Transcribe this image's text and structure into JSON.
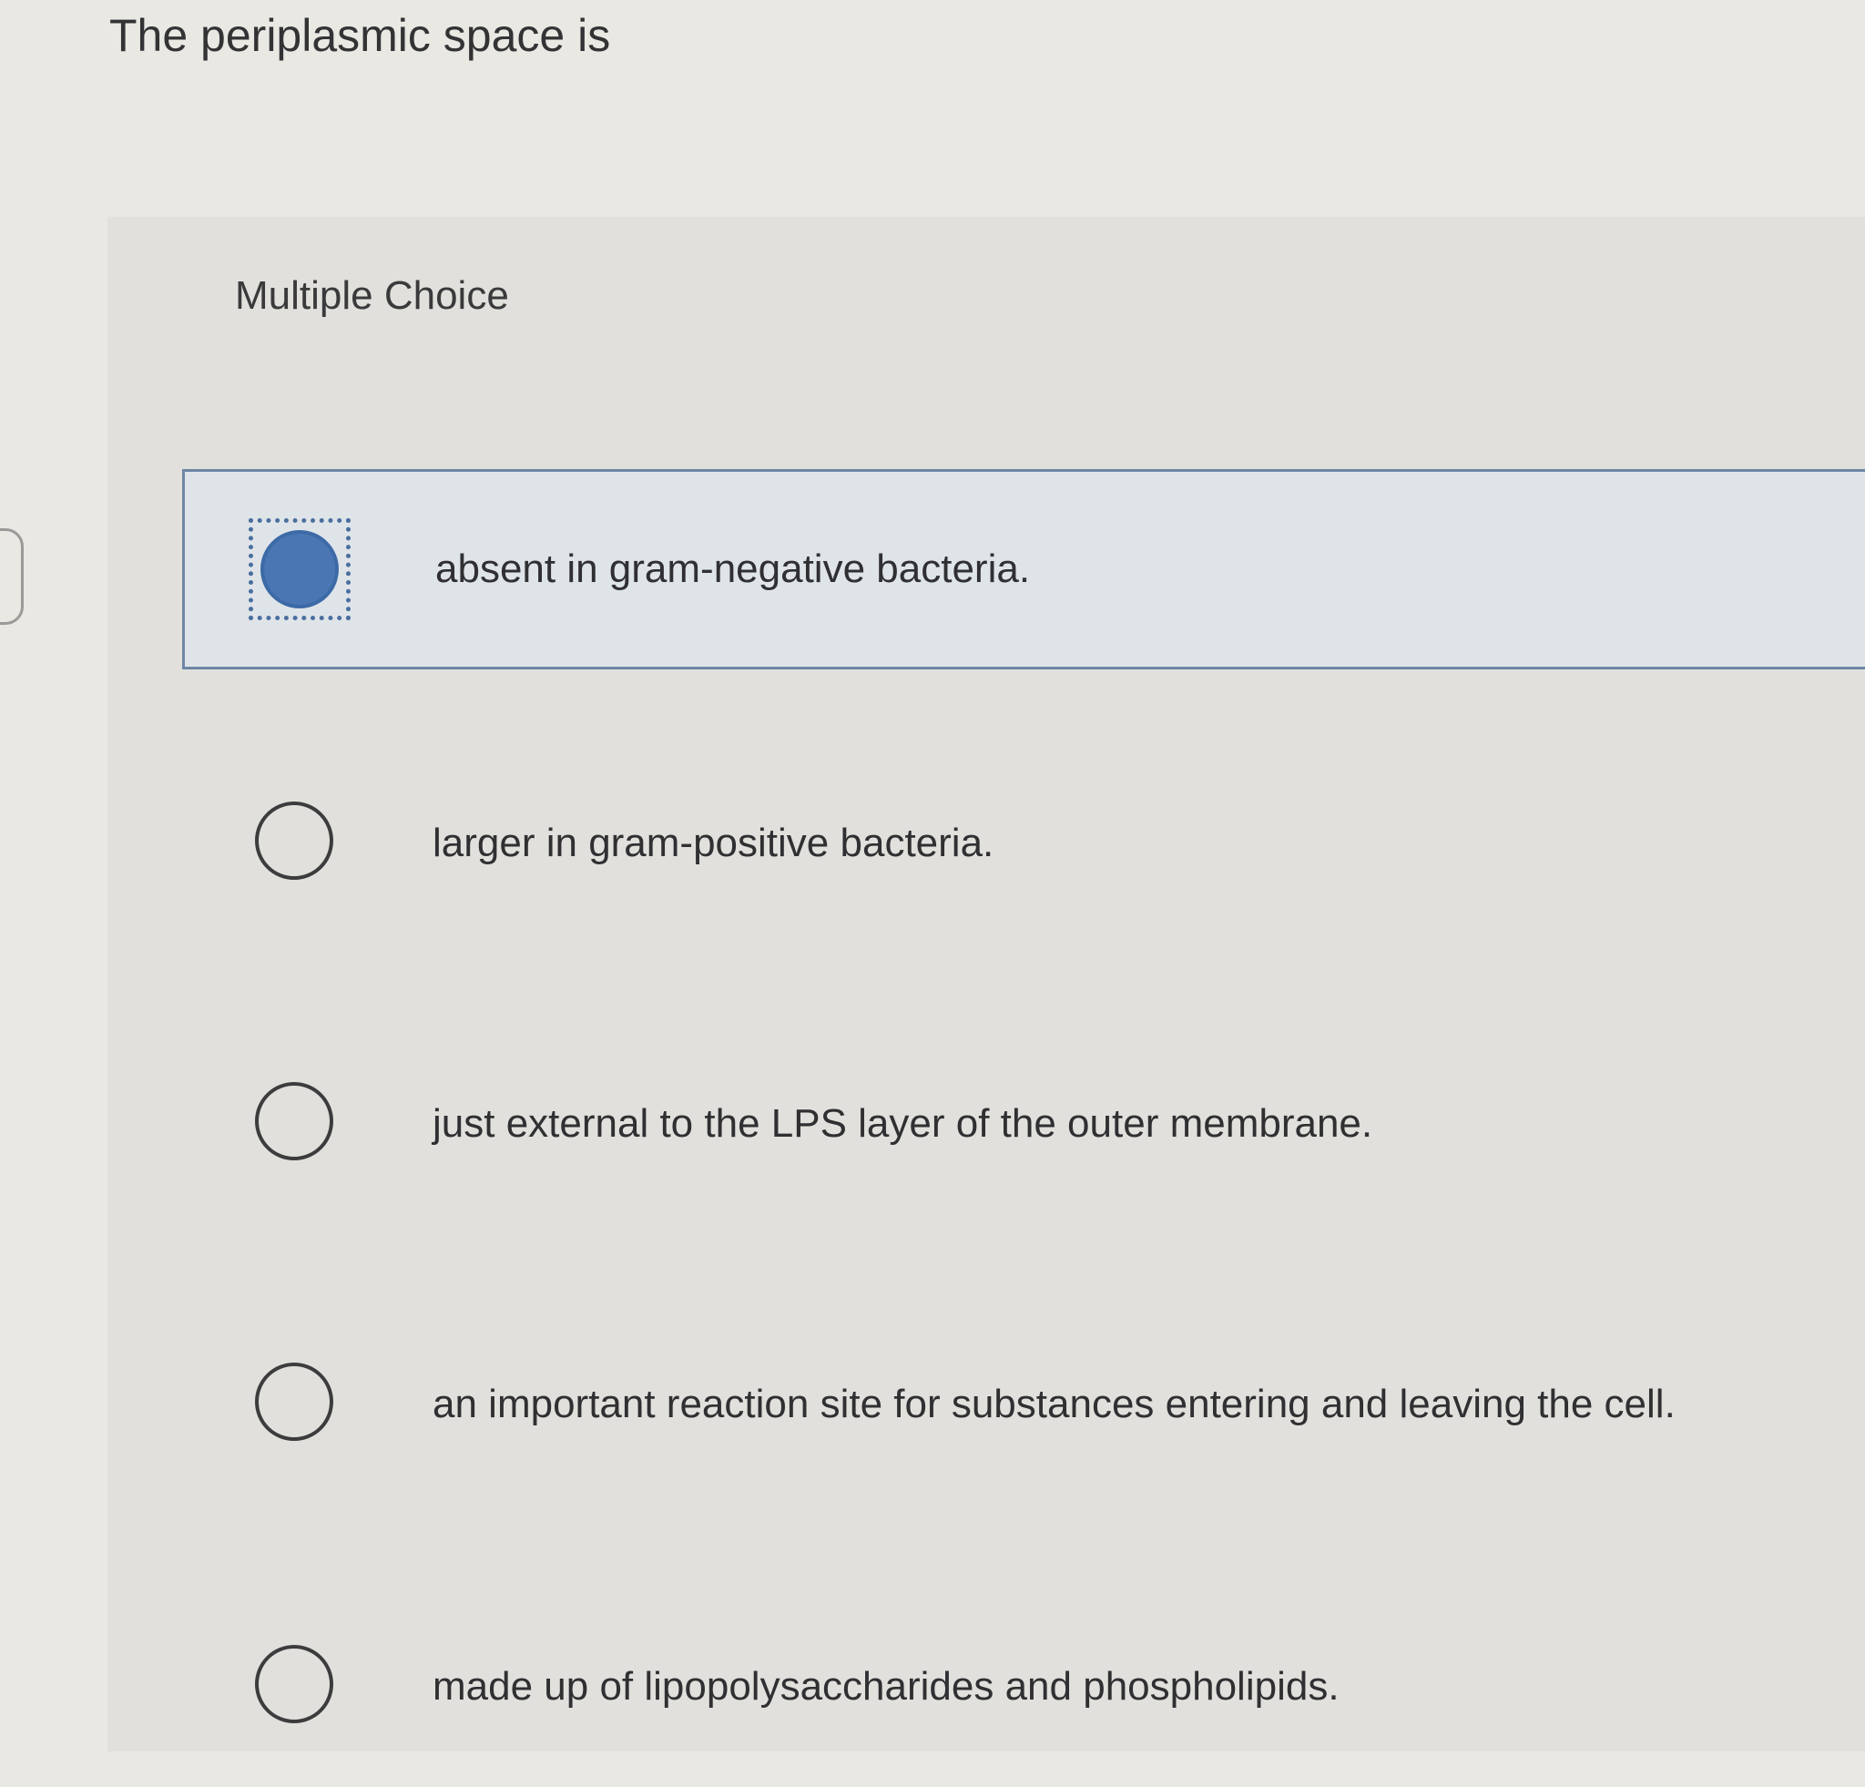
{
  "question": {
    "title": "The periplasmic space is"
  },
  "panel": {
    "label": "Multiple Choice"
  },
  "choices": [
    {
      "text": "absent in gram-negative bacteria.",
      "selected": true
    },
    {
      "text": "larger in gram-positive bacteria.",
      "selected": false
    },
    {
      "text": "just external to the LPS layer of the outer membrane.",
      "selected": false
    },
    {
      "text": "an important reaction site for substances entering and leaving the cell.",
      "selected": false
    },
    {
      "text": "made up of lipopolysaccharides and phospholipids.",
      "selected": false
    }
  ],
  "colors": {
    "selected_fill": "#4a77b4",
    "selected_border": "#6d87a5",
    "selected_bg": "#dfe4e9"
  }
}
